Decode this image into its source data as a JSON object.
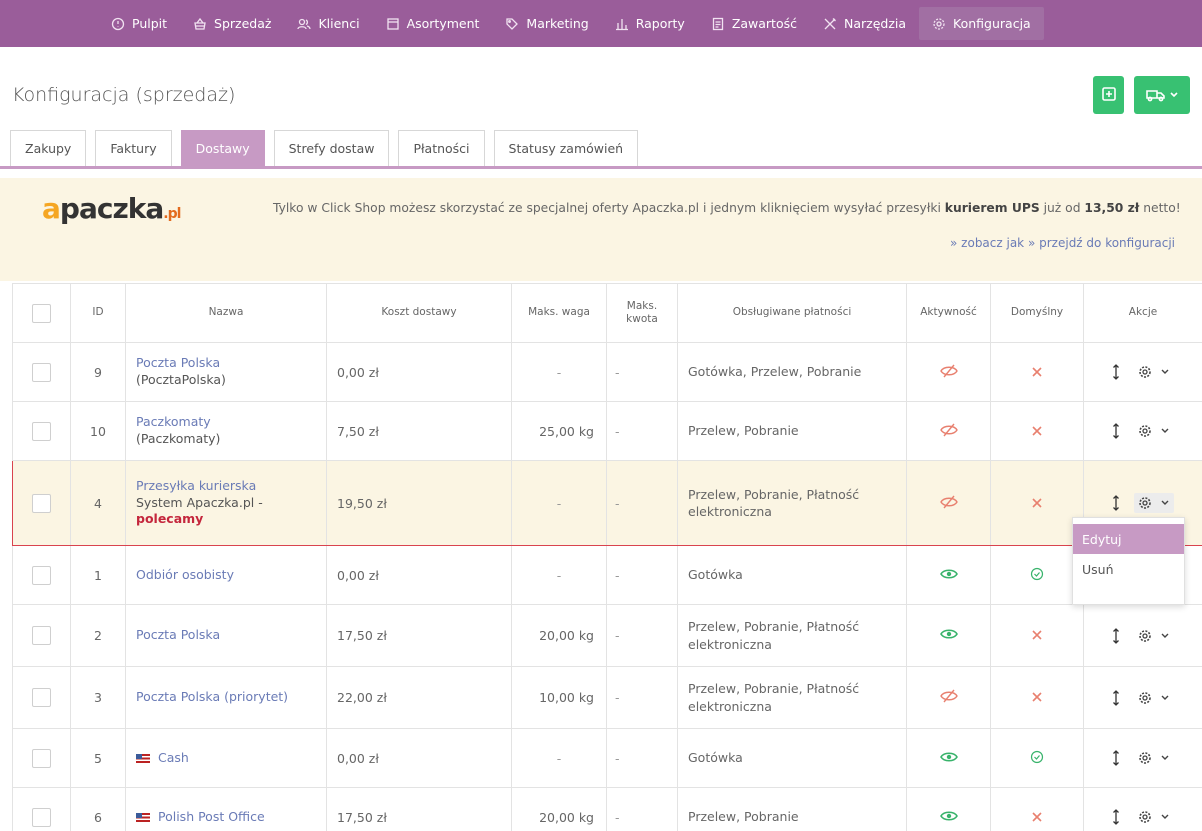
{
  "nav": {
    "items": [
      {
        "label": "Pulpit",
        "icon": "gauge-icon"
      },
      {
        "label": "Sprzedaż",
        "icon": "basket-icon"
      },
      {
        "label": "Klienci",
        "icon": "users-icon"
      },
      {
        "label": "Asortyment",
        "icon": "box-icon"
      },
      {
        "label": "Marketing",
        "icon": "tag-icon"
      },
      {
        "label": "Raporty",
        "icon": "bars-icon"
      },
      {
        "label": "Zawartość",
        "icon": "document-icon"
      },
      {
        "label": "Narzędzia",
        "icon": "tools-icon"
      },
      {
        "label": "Konfiguracja",
        "icon": "gear-icon"
      }
    ],
    "active": "Konfiguracja",
    "bg_color": "#9a5d9a"
  },
  "header": {
    "title": "Konfiguracja (sprzedaż)",
    "add_button_icon": "plus-square-icon",
    "truck_button_icon": "truck-icon",
    "button_color": "#38c172"
  },
  "tabs": [
    "Zakupy",
    "Faktury",
    "Dostawy",
    "Strefy dostaw",
    "Płatności",
    "Statusy zamówień"
  ],
  "active_tab": "Dostawy",
  "banner": {
    "logo_a": "a",
    "logo_rest": "paczka",
    "logo_pl": ".pl",
    "text_1": "Tylko w Click Shop możesz skorzystać ze specjalnej oferty Apaczka.pl i jednym kliknięciem wysyłać przesyłki ",
    "text_bold_1": "kurierem UPS",
    "text_2": " już od ",
    "text_bold_2": "13,50 zł",
    "text_3": " netto!",
    "link_1": "» zobacz jak",
    "link_2": "» przejdź do konfiguracji"
  },
  "table": {
    "headers": {
      "id": "ID",
      "name": "Nazwa",
      "cost": "Koszt dostawy",
      "weight": "Maks. waga",
      "amount_1": "Maks.",
      "amount_2": "kwota",
      "payments": "Obsługiwane płatności",
      "active": "Aktywność",
      "default": "Domyślny",
      "actions": "Akcje"
    },
    "rows": [
      {
        "id": "9",
        "name": "Poczta Polska",
        "sub": "(PocztaPolska)",
        "cost": "0,00 zł",
        "weight": "-",
        "amount": "-",
        "payments": "Gotówka, Przelew, Pobranie",
        "active": false,
        "default": false
      },
      {
        "id": "10",
        "name": "Paczkomaty",
        "sub": "(Paczkomaty)",
        "cost": "7,50 zł",
        "weight": "25,00 kg",
        "amount": "-",
        "payments": "Przelew, Pobranie",
        "active": false,
        "default": false
      },
      {
        "id": "4",
        "name": "Przesyłka kurierska",
        "sub": "System Apaczka.pl -",
        "sub_red": "polecamy",
        "cost": "19,50 zł",
        "weight": "-",
        "amount": "-",
        "payments": "Przelew, Pobranie, Płatność elektroniczna",
        "active": false,
        "default": false,
        "highlighted": true
      },
      {
        "id": "1",
        "name": "Odbiór osobisty",
        "cost": "0,00 zł",
        "weight": "-",
        "amount": "-",
        "payments": "Gotówka",
        "active": true,
        "default": true
      },
      {
        "id": "2",
        "name": "Poczta Polska",
        "cost": "17,50 zł",
        "weight": "20,00 kg",
        "amount": "-",
        "payments": "Przelew, Pobranie, Płatność elektroniczna",
        "active": true,
        "default": false
      },
      {
        "id": "3",
        "name": "Poczta Polska (priorytet)",
        "cost": "22,00 zł",
        "weight": "10,00 kg",
        "amount": "-",
        "payments": "Przelew, Pobranie, Płatność elektroniczna",
        "active": false,
        "default": false
      },
      {
        "id": "5",
        "name": "Cash",
        "flag": true,
        "cost": "0,00 zł",
        "weight": "-",
        "amount": "-",
        "payments": "Gotówka",
        "active": true,
        "default": true
      },
      {
        "id": "6",
        "name": "Polish Post Office",
        "flag": true,
        "cost": "17,50 zł",
        "weight": "20,00 kg",
        "amount": "-",
        "payments": "Przelew, Pobranie",
        "active": true,
        "default": false
      }
    ]
  },
  "dropdown": {
    "items": [
      "Edytuj",
      "Usuń"
    ],
    "hovered": "Edytuj"
  },
  "colors": {
    "accent": "#c79ac4",
    "link": "#6a7bb6",
    "active_green": "#38b36b",
    "inactive_red": "#e8806f",
    "highlight_border": "#d9434e",
    "banner_bg": "#fbf5e3"
  }
}
